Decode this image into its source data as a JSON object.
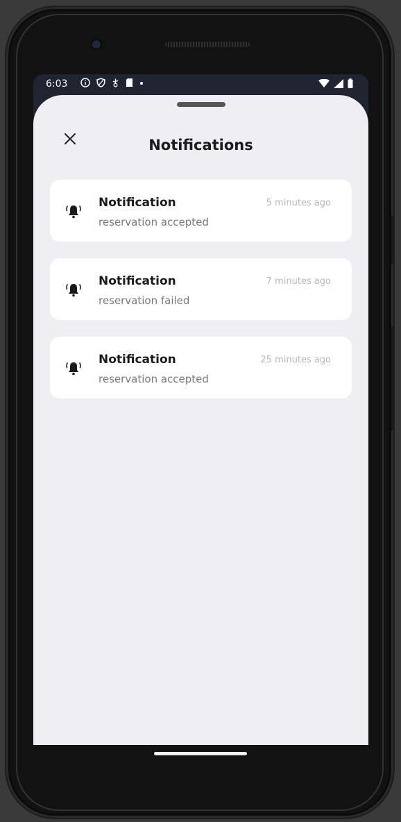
{
  "status_bar": {
    "time": "6:03",
    "left_icons": [
      "info-icon",
      "shield-icon",
      "usb-icon",
      "sd-card-icon",
      "dot-icon"
    ],
    "right_icons": [
      "wifi-icon",
      "signal-icon",
      "battery-icon"
    ]
  },
  "sheet": {
    "title": "Notifications",
    "close_icon": "close-icon"
  },
  "notifications": [
    {
      "icon": "bell-ringing-icon",
      "title": "Notification",
      "body": "reservation accepted",
      "time": "5 minutes ago"
    },
    {
      "icon": "bell-ringing-icon",
      "title": "Notification",
      "body": "reservation failed",
      "time": "7 minutes ago"
    },
    {
      "icon": "bell-ringing-icon",
      "title": "Notification",
      "body": "reservation accepted",
      "time": "25 minutes ago"
    }
  ],
  "colors": {
    "sheet_background": "#efeef3",
    "card_background": "#ffffff",
    "status_bar_background": "#1e2530",
    "time_text": "#b8b8b8",
    "body_text": "#7a7a7a"
  }
}
